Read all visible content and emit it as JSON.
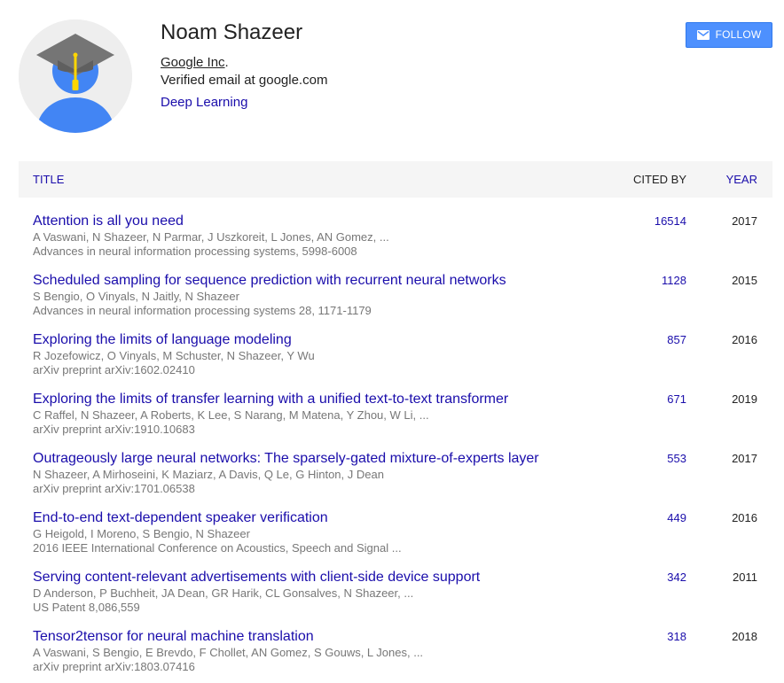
{
  "profile": {
    "name": "Noam Shazeer",
    "affiliation": "Google Inc",
    "affiliation_suffix": ".",
    "email": "Verified email at google.com",
    "interest": "Deep Learning",
    "avatar_icon": "default-scholar-avatar"
  },
  "follow": {
    "label": "FOLLOW",
    "icon": "mail-icon",
    "color": "#4d90fe"
  },
  "table": {
    "headers": {
      "title": "TITLE",
      "cited_by": "CITED BY",
      "year": "YEAR"
    },
    "rows": [
      {
        "title": "Attention is all you need",
        "authors": "A Vaswani, N Shazeer, N Parmar, J Uszkoreit, L Jones, AN Gomez, ...",
        "venue": "Advances in neural information processing systems, 5998-6008",
        "cited_by": "16514",
        "year": "2017"
      },
      {
        "title": "Scheduled sampling for sequence prediction with recurrent neural networks",
        "authors": "S Bengio, O Vinyals, N Jaitly, N Shazeer",
        "venue": "Advances in neural information processing systems 28, 1171-1179",
        "cited_by": "1128",
        "year": "2015"
      },
      {
        "title": "Exploring the limits of language modeling",
        "authors": "R Jozefowicz, O Vinyals, M Schuster, N Shazeer, Y Wu",
        "venue": "arXiv preprint arXiv:1602.02410",
        "cited_by": "857",
        "year": "2016"
      },
      {
        "title": "Exploring the limits of transfer learning with a unified text-to-text transformer",
        "authors": "C Raffel, N Shazeer, A Roberts, K Lee, S Narang, M Matena, Y Zhou, W Li, ...",
        "venue": "arXiv preprint arXiv:1910.10683",
        "cited_by": "671",
        "year": "2019"
      },
      {
        "title": "Outrageously large neural networks: The sparsely-gated mixture-of-experts layer",
        "authors": "N Shazeer, A Mirhoseini, K Maziarz, A Davis, Q Le, G Hinton, J Dean",
        "venue": "arXiv preprint arXiv:1701.06538",
        "cited_by": "553",
        "year": "2017"
      },
      {
        "title": "End-to-end text-dependent speaker verification",
        "authors": "G Heigold, I Moreno, S Bengio, N Shazeer",
        "venue": "2016 IEEE International Conference on Acoustics, Speech and Signal ...",
        "cited_by": "449",
        "year": "2016"
      },
      {
        "title": "Serving content-relevant advertisements with client-side device support",
        "authors": "D Anderson, P Buchheit, JA Dean, GR Harik, CL Gonsalves, N Shazeer, ...",
        "venue": "US Patent 8,086,559",
        "cited_by": "342",
        "year": "2011"
      },
      {
        "title": "Tensor2tensor for neural machine translation",
        "authors": "A Vaswani, S Bengio, E Brevdo, F Chollet, AN Gomez, S Gouws, L Jones, ...",
        "venue": "arXiv preprint arXiv:1803.07416",
        "cited_by": "318",
        "year": "2018"
      }
    ]
  }
}
